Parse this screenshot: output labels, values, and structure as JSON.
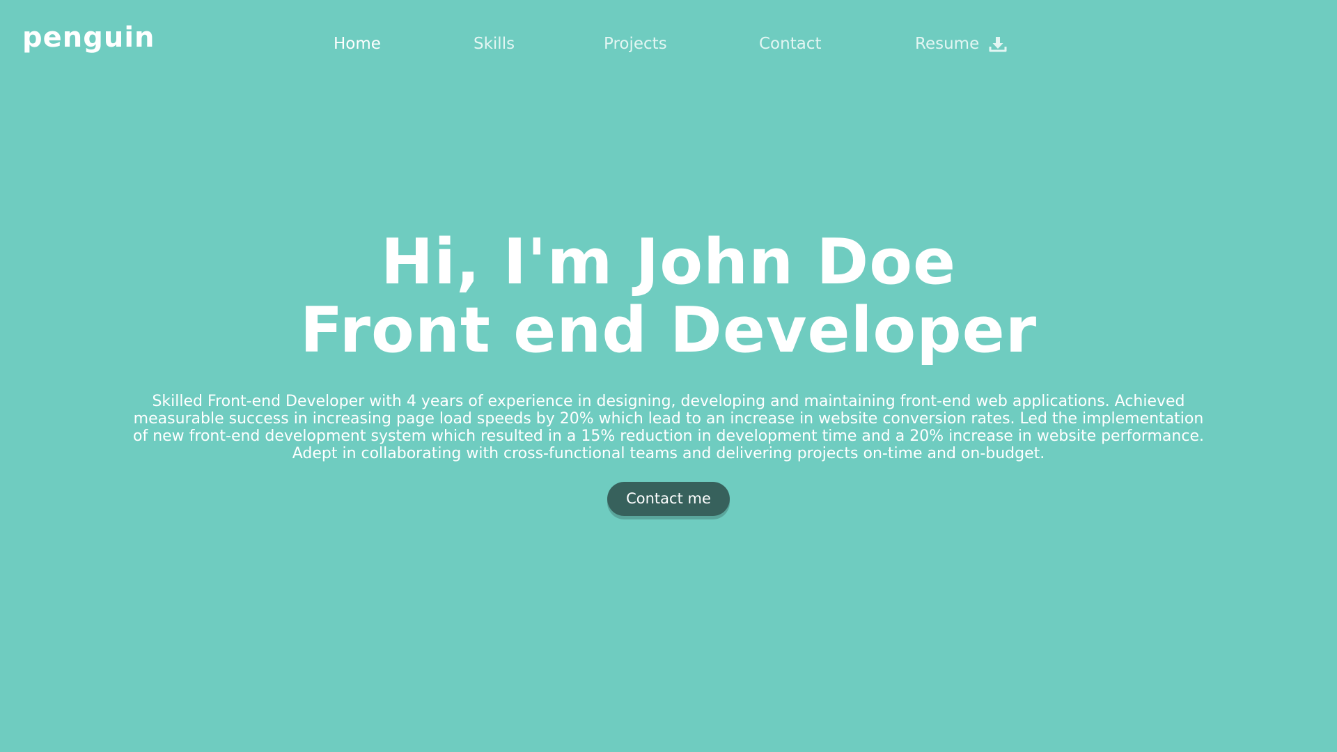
{
  "brand": {
    "logo_text": "penguin"
  },
  "nav": {
    "items": [
      {
        "label": "Home"
      },
      {
        "label": "Skills"
      },
      {
        "label": "Projects"
      },
      {
        "label": "Contact"
      },
      {
        "label": "Resume",
        "icon": "download-icon"
      }
    ],
    "active": "Home"
  },
  "hero": {
    "title_line1": "Hi, I'm John Doe",
    "title_line2": "Front end Developer",
    "description": "Skilled Front-end Developer with 4 years of experience in designing, developing and maintaining front-end web applications. Achieved measurable success in increasing page load speeds by 20% which lead to an increase in website conversion rates. Led the implementation of new front-end development system which resulted in a 15% reduction in development time and a 20% increase in website performance. Adept in collaborating with cross-functional teams and delivering projects on-time and on-budget.",
    "cta_label": "Contact me"
  },
  "colors": {
    "background": "#6fccc0",
    "text": "#ffffff",
    "nav_inactive": "#e3f6f3",
    "button": "#37615c",
    "button_shadow": "#5aa69c"
  }
}
